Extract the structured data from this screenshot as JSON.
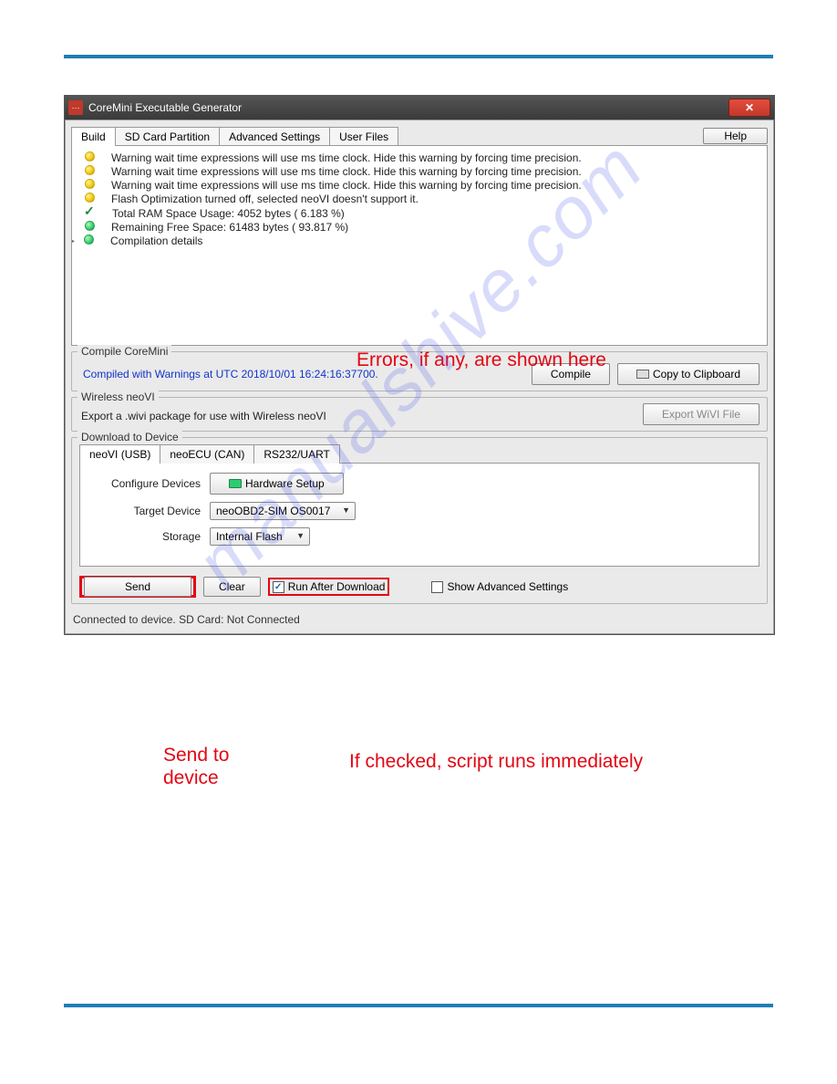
{
  "window": {
    "title": "CoreMini Executable Generator"
  },
  "tabs": [
    "Build",
    "SD Card Partition",
    "Advanced Settings",
    "User Files"
  ],
  "help_label": "Help",
  "log": [
    {
      "icon": "y",
      "text": "Warning wait time expressions will use ms time clock. Hide this warning by forcing time precision."
    },
    {
      "icon": "y",
      "text": "Warning wait time expressions will use ms time clock. Hide this warning by forcing time precision."
    },
    {
      "icon": "y",
      "text": "Warning wait time expressions will use ms time clock. Hide this warning by forcing time precision."
    },
    {
      "icon": "y",
      "text": "Flash Optimization turned off, selected neoVI doesn't support it."
    },
    {
      "icon": "chk",
      "text": "Total RAM Space Usage: 4052 bytes ( 6.183 %)"
    },
    {
      "icon": "g",
      "text": "Remaining Free Space: 61483 bytes ( 93.817 %)"
    },
    {
      "icon": "g",
      "text": "Compilation details",
      "group": true
    }
  ],
  "compile": {
    "legend": "Compile CoreMini",
    "status": "Compiled with Warnings at UTC 2018/10/01 16:24:16:37700.",
    "compile_btn": "Compile",
    "copy_btn": "Copy to Clipboard"
  },
  "wireless": {
    "legend": "Wireless neoVI",
    "desc": "Export a .wivi package for use with Wireless neoVI",
    "export_btn": "Export WiVI File"
  },
  "download": {
    "legend": "Download to Device",
    "tabs": [
      "neoVI (USB)",
      "neoECU (CAN)",
      "RS232/UART"
    ],
    "configure_lbl": "Configure Devices",
    "hw_btn": "Hardware Setup",
    "target_lbl": "Target Device",
    "target_val": "neoOBD2-SIM OS0017",
    "storage_lbl": "Storage",
    "storage_val": "Internal Flash"
  },
  "bottom": {
    "send": "Send",
    "clear": "Clear",
    "run_after": "Run After Download",
    "show_adv": "Show Advanced Settings"
  },
  "status_bar": "Connected to device. SD Card: Not Connected",
  "annotations": {
    "errors": "Errors, if any, are shown here",
    "send_to": "Send to\ndevice",
    "run_note": "If checked, script runs immediately"
  },
  "watermark": "manualshive.com"
}
